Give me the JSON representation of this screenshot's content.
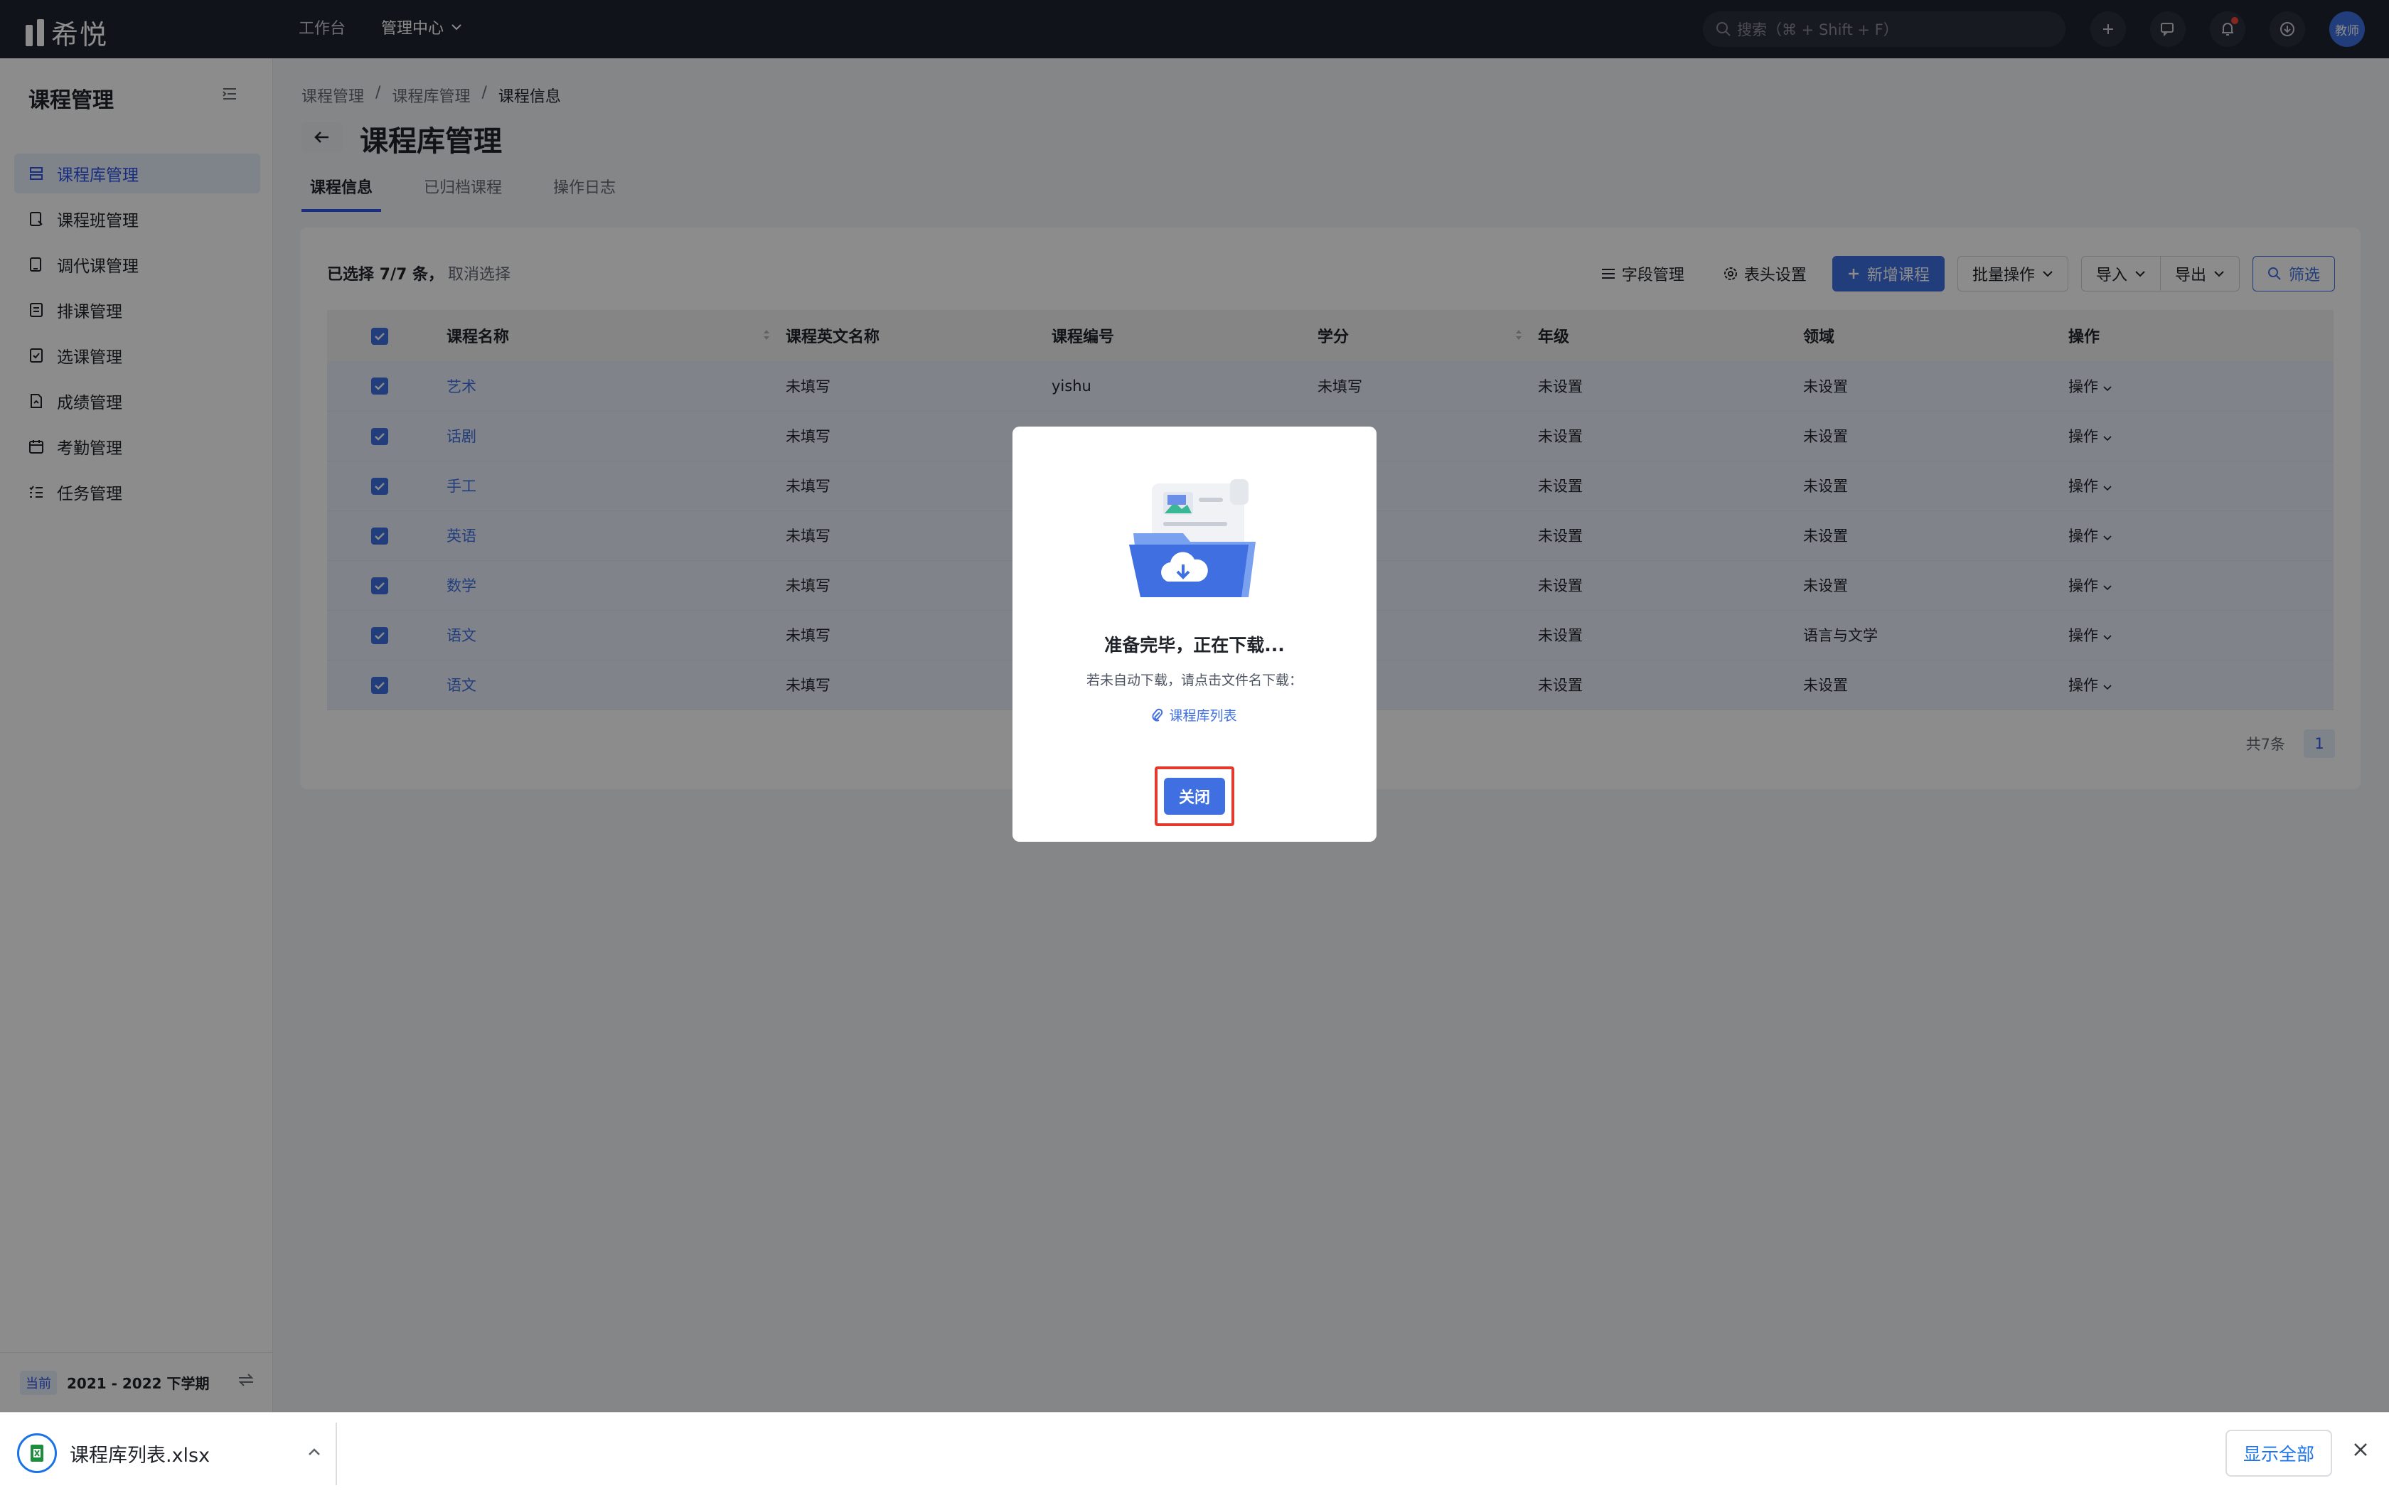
{
  "app": {
    "logo_text": "希悦"
  },
  "topnav": {
    "items": [
      "工作台"
    ],
    "active": "管理中心"
  },
  "search": {
    "placeholder": "搜索（⌘ + Shift + F）"
  },
  "user": {
    "avatar_text": "教师"
  },
  "sidebar": {
    "title": "课程管理",
    "items": [
      {
        "label": "课程库管理",
        "active": true,
        "icon": "library-icon"
      },
      {
        "label": "课程班管理",
        "icon": "class-icon"
      },
      {
        "label": "调代课管理",
        "icon": "substitute-icon"
      },
      {
        "label": "排课管理",
        "icon": "schedule-icon"
      },
      {
        "label": "选课管理",
        "icon": "selection-icon"
      },
      {
        "label": "成绩管理",
        "icon": "grade-icon"
      },
      {
        "label": "考勤管理",
        "icon": "attendance-icon"
      },
      {
        "label": "任务管理",
        "icon": "task-icon"
      }
    ],
    "footer": {
      "tag": "当前",
      "term": "2021 - 2022 下学期"
    }
  },
  "breadcrumb": [
    "课程管理",
    "课程库管理",
    "课程信息"
  ],
  "page": {
    "title": "课程库管理"
  },
  "tabs": [
    {
      "label": "课程信息",
      "active": true
    },
    {
      "label": "已归档课程"
    },
    {
      "label": "操作日志"
    }
  ],
  "selection": {
    "text": "已选择 7/7 条，",
    "cancel": "取消选择"
  },
  "toolbar": {
    "field_manage": "字段管理",
    "header_settings": "表头设置",
    "add_course": "新增课程",
    "batch": "批量操作",
    "import": "导入",
    "export": "导出",
    "filter": "筛选"
  },
  "table": {
    "headers": [
      "课程名称",
      "课程英文名称",
      "课程编号",
      "学分",
      "年级",
      "领域",
      "操作"
    ],
    "rows": [
      {
        "name": "艺术",
        "en": "未填写",
        "code": "yishu",
        "credit": "未填写",
        "grade": "未设置",
        "area": "未设置",
        "op": "操作"
      },
      {
        "name": "话剧",
        "en": "未填写",
        "code": "",
        "credit": "",
        "grade": "未设置",
        "area": "未设置",
        "op": "操作"
      },
      {
        "name": "手工",
        "en": "未填写",
        "code": "",
        "credit": "",
        "grade": "未设置",
        "area": "未设置",
        "op": "操作"
      },
      {
        "name": "英语",
        "en": "未填写",
        "code": "",
        "credit": "",
        "grade": "未设置",
        "area": "未设置",
        "op": "操作"
      },
      {
        "name": "数学",
        "en": "未填写",
        "code": "",
        "credit": "",
        "grade": "未设置",
        "area": "未设置",
        "op": "操作"
      },
      {
        "name": "语文",
        "en": "未填写",
        "code": "",
        "credit": "",
        "grade": "未设置",
        "area": "语言与文学",
        "op": "操作"
      },
      {
        "name": "语文",
        "en": "未填写",
        "code": "",
        "credit": "",
        "grade": "未设置",
        "area": "未设置",
        "op": "操作"
      }
    ]
  },
  "pagination": {
    "total": "共7条",
    "page": "1"
  },
  "modal": {
    "title": "准备完毕，正在下载...",
    "subtitle": "若未自动下载，请点击文件名下载：",
    "link": "课程库列表",
    "close": "关闭"
  },
  "download_bar": {
    "file": "课程库列表.xlsx",
    "show_all": "显示全部"
  },
  "colors": {
    "primary": "#3f6fe0",
    "topbar": "#1f2430",
    "highlight": "#e23b2e"
  }
}
